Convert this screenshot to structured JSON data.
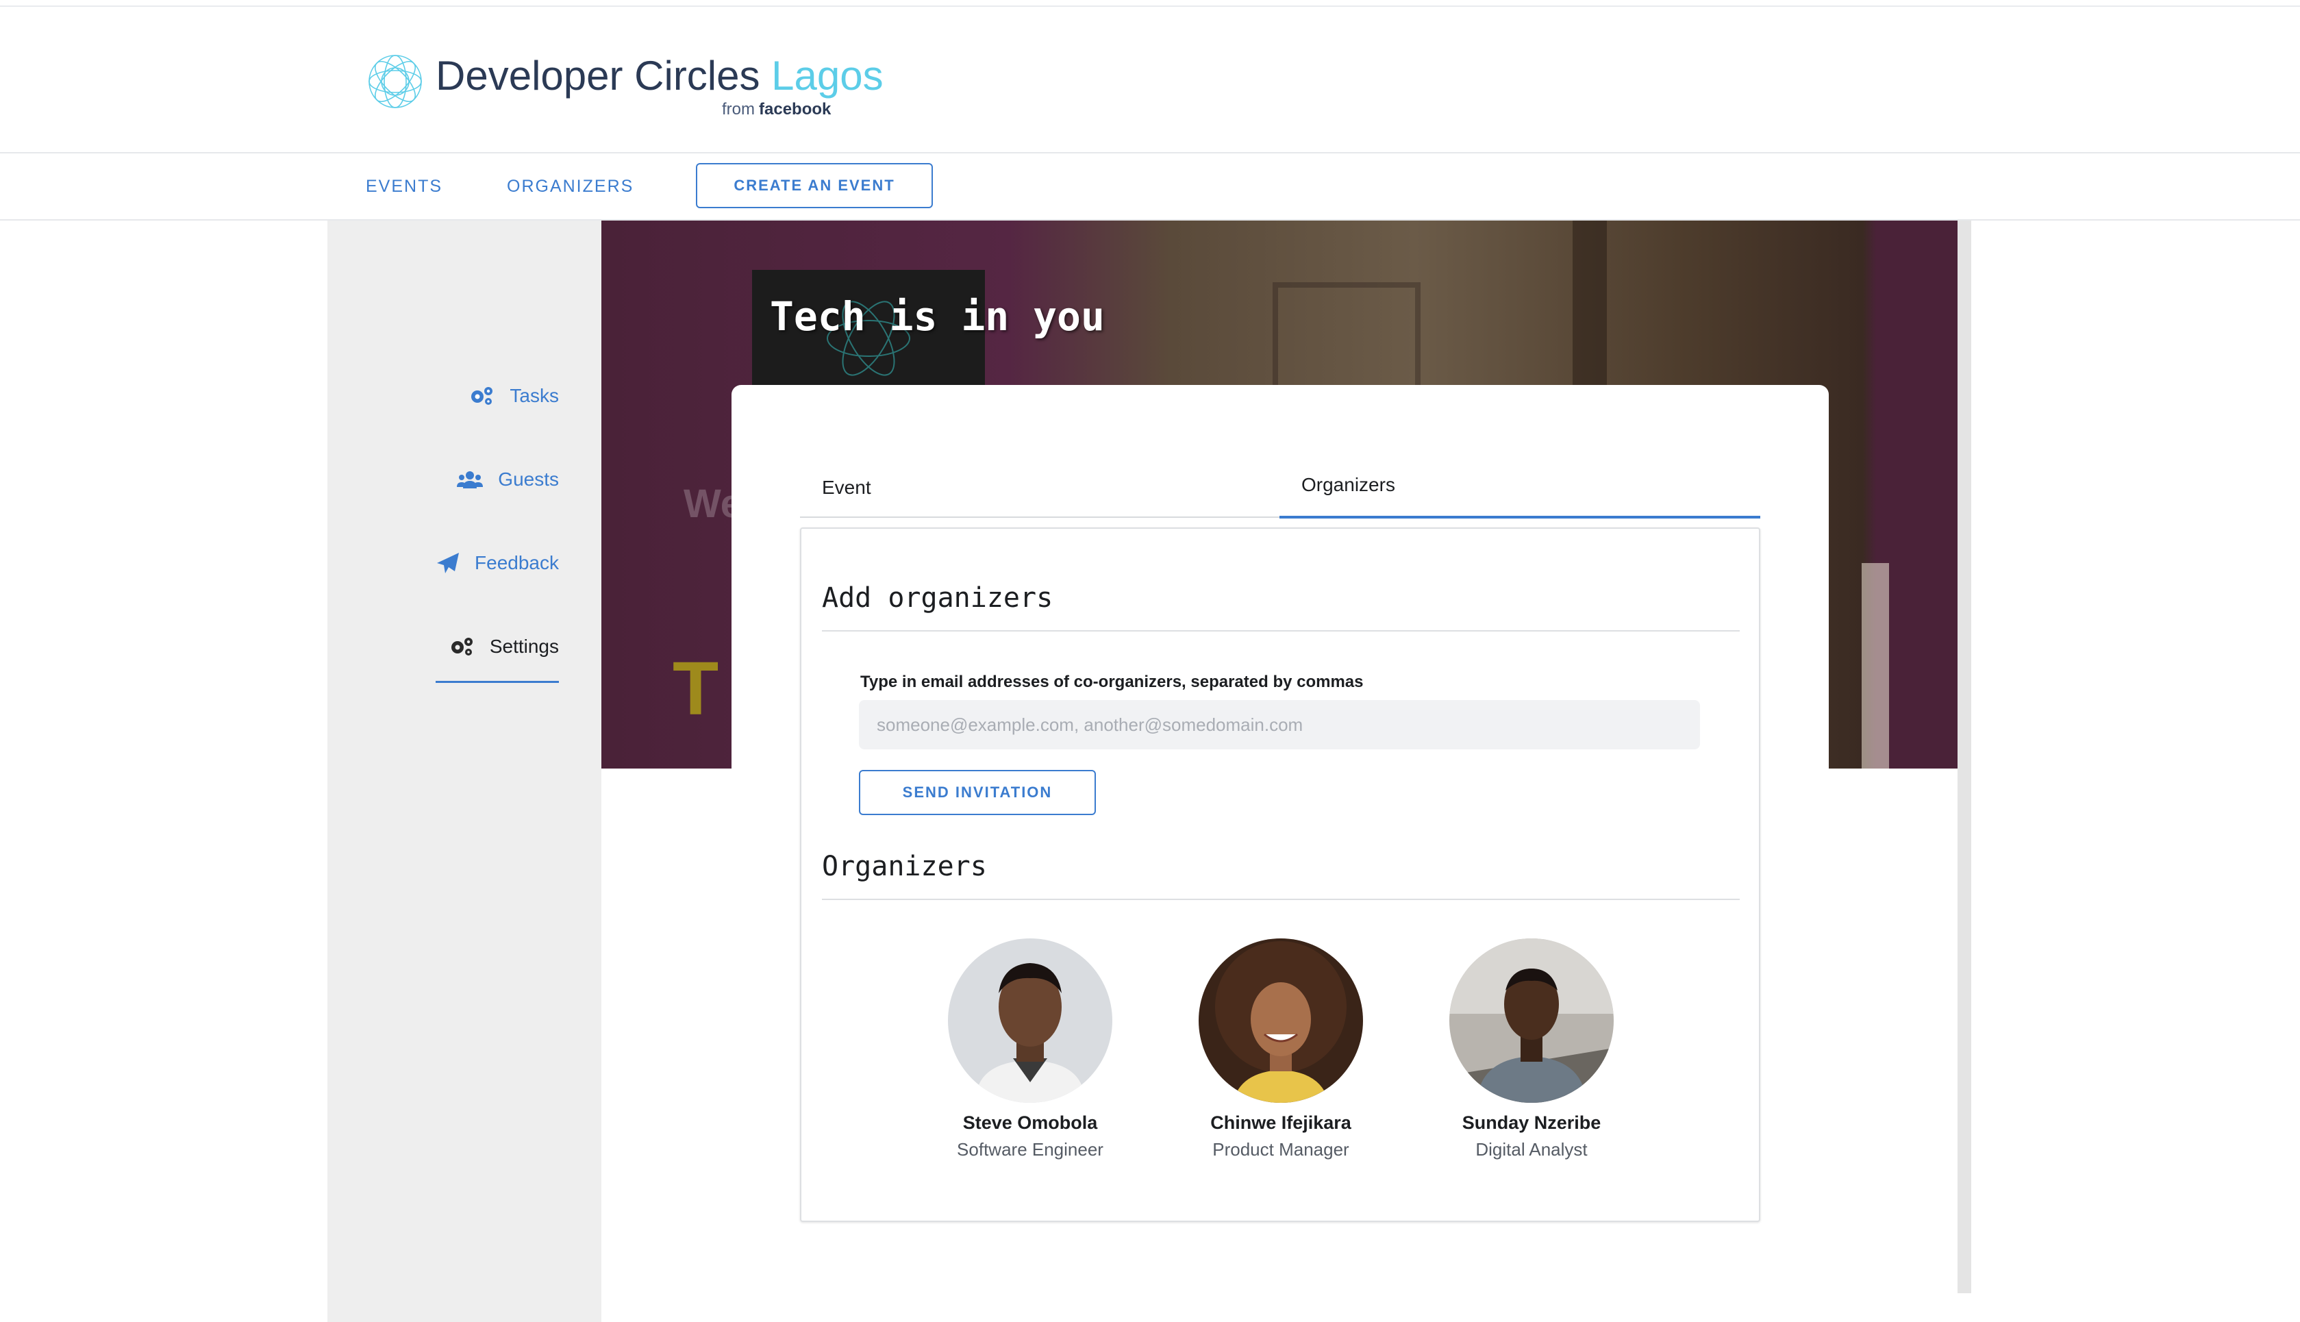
{
  "header": {
    "brand_main": "Developer Circles",
    "brand_city": "Lagos",
    "brand_from": "from",
    "brand_company": "facebook",
    "logo_icon": "circles-logo-icon"
  },
  "nav": {
    "events": "EVENTS",
    "organizers": "ORGANIZERS",
    "create_event": "CREATE AN EVENT"
  },
  "sidebar": {
    "items": [
      {
        "label": "Tasks",
        "icon": "gears-icon",
        "active": false
      },
      {
        "label": "Guests",
        "icon": "users-icon",
        "active": false
      },
      {
        "label": "Feedback",
        "icon": "paper-plane-icon",
        "active": false
      },
      {
        "label": "Settings",
        "icon": "gears-icon",
        "active": true
      }
    ]
  },
  "banner": {
    "tagline": "Tech is in you"
  },
  "tabs": {
    "event": "Event",
    "organizers": "Organizers",
    "active": "organizers"
  },
  "add_organizers": {
    "title": "Add organizers",
    "field_label": "Type in email addresses of co-organizers, separated by commas",
    "placeholder": "someone@example.com, another@somedomain.com",
    "value": "",
    "send_button": "SEND INVITATION"
  },
  "organizers": {
    "title": "Organizers",
    "people": [
      {
        "name": "Steve Omobola",
        "role": "Software Engineer"
      },
      {
        "name": "Chinwe Ifejikara",
        "role": "Product Manager"
      },
      {
        "name": "Sunday Nzeribe",
        "role": "Digital Analyst"
      }
    ]
  },
  "colors": {
    "accent": "#3b7ccf",
    "brand_city": "#5ccde8",
    "banner_purple": "#4a2238",
    "sidebar_bg": "#eeeeee"
  }
}
